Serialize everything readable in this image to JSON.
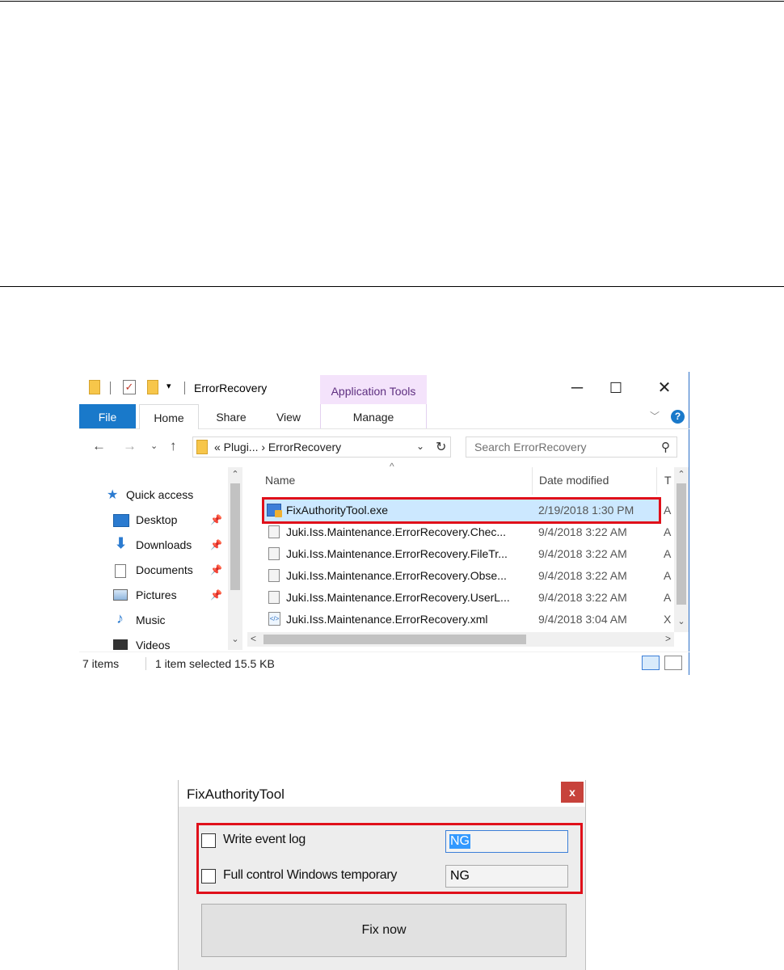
{
  "explorer": {
    "title": "ErrorRecovery",
    "contextual_tab": "Application Tools",
    "ribbon_tabs": [
      "File",
      "Home",
      "Share",
      "View",
      "Manage"
    ],
    "address": {
      "path": "«  Plugi...  ›  ErrorRecovery"
    },
    "search": {
      "placeholder": "Search ErrorRecovery"
    },
    "nav_items": [
      {
        "label": "Quick access",
        "icon": "star-icon"
      },
      {
        "label": "Desktop",
        "icon": "desktop-icon"
      },
      {
        "label": "Downloads",
        "icon": "download-arrow-icon"
      },
      {
        "label": "Documents",
        "icon": "document-icon"
      },
      {
        "label": "Pictures",
        "icon": "pictures-icon"
      },
      {
        "label": "Music",
        "icon": "music-note-icon"
      },
      {
        "label": "Videos",
        "icon": "film-icon"
      }
    ],
    "columns": {
      "name": "Name",
      "date": "Date modified",
      "type": "T"
    },
    "files": [
      {
        "name": "FixAuthorityTool.exe",
        "date": "2/19/2018 1:30 PM",
        "type": "A",
        "selected": true
      },
      {
        "name": "Juki.Iss.Maintenance.ErrorRecovery.Chec...",
        "date": "9/4/2018 3:22 AM",
        "type": "A"
      },
      {
        "name": "Juki.Iss.Maintenance.ErrorRecovery.FileTr...",
        "date": "9/4/2018 3:22 AM",
        "type": "A"
      },
      {
        "name": "Juki.Iss.Maintenance.ErrorRecovery.Obse...",
        "date": "9/4/2018 3:22 AM",
        "type": "A"
      },
      {
        "name": "Juki.Iss.Maintenance.ErrorRecovery.UserL...",
        "date": "9/4/2018 3:22 AM",
        "type": "A"
      },
      {
        "name": "Juki.Iss.Maintenance.ErrorRecovery.xml",
        "date": "9/4/2018 3:04 AM",
        "type": "X"
      }
    ],
    "status": {
      "items": "7 items",
      "selection": "1 item selected  15.5 KB"
    },
    "accent_color": "#1979ca",
    "highlight_color": "#e0101a"
  },
  "dialog": {
    "title": "FixAuthorityTool",
    "close_label": "x",
    "options": [
      {
        "label": "Write event log",
        "checked": false,
        "value": "NG"
      },
      {
        "label": "Full control Windows temporary",
        "checked": false,
        "value": "NG"
      }
    ],
    "fix_button": "Fix now"
  }
}
